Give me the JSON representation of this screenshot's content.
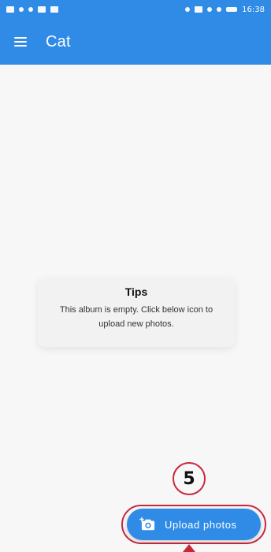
{
  "status_bar": {
    "time": "16:38"
  },
  "app_bar": {
    "title": "Cat"
  },
  "tips": {
    "title": "Tips",
    "message": "This album is empty. Click below icon to upload new photos."
  },
  "annotation": {
    "step_number": "5"
  },
  "upload": {
    "label": "Upload photos"
  },
  "colors": {
    "primary": "#2f8be6",
    "annotation": "#c8283a"
  },
  "icons": {
    "menu": "menu-icon",
    "upload": "camera-add-icon"
  }
}
